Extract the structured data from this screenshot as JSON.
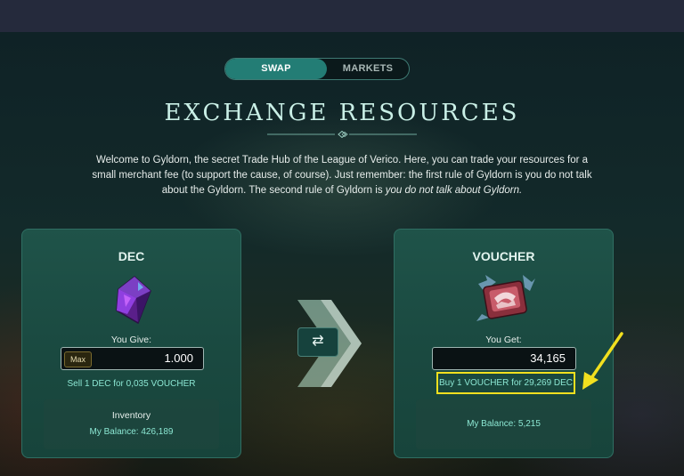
{
  "colors": {
    "accent": "#237d75",
    "highlight": "#f2e01f",
    "rate_text": "#8be6d2"
  },
  "nav": {
    "tabs": [
      {
        "label": "SWAP",
        "active": true
      },
      {
        "label": "MARKETS",
        "active": false
      }
    ]
  },
  "header": {
    "title": "EXCHANGE RESOURCES",
    "description_main": "Welcome to Gyldorn, the secret Trade Hub of the League of Verico. Here, you can trade your resources for a small merchant fee (to support the cause, of course). Just remember: the first rule of Gyldorn is you do not talk about the Gyldorn. The second rule of Gyldorn is ",
    "description_emphasis": "you do not talk about Gyldorn."
  },
  "give_card": {
    "title": "DEC",
    "icon": "dec-crystal-icon",
    "label": "You Give:",
    "max_label": "Max",
    "amount": "1.000",
    "rate": "Sell 1 DEC for 0,035 VOUCHER",
    "inventory_title": "Inventory",
    "balance": "My Balance: 426,189"
  },
  "swap_icon": "swap-arrows-icon",
  "get_card": {
    "title": "VOUCHER",
    "icon": "voucher-icon",
    "label": "You Get:",
    "amount": "34,165",
    "rate": "Buy 1 VOUCHER for 29,269 DEC",
    "balance": "My Balance: 5,215"
  }
}
